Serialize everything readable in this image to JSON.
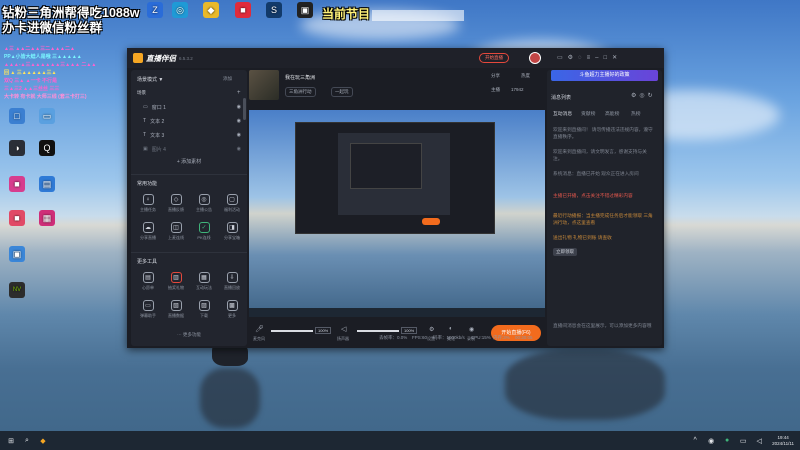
{
  "overlay": {
    "line1": "钻粉三角洲帮得吃1088w",
    "line2": "办卡进微信粉丝群",
    "program_label": "当前节目",
    "small_lines": [
      "▲三 ▲▲二▲▲三二▲▲▲二▲",
      "PP▲小皆大蛙人是哦 三▲▲▲▲▲",
      "▲▲▲-▲三▲▲▲▲▲▲三▲▲▲  二▲▲",
      "回 ▲ 三▲▲▲▲▲三▲",
      "双Q   三▲ ▲一卡 不行是",
      "三▲三2 ▲▲三丝丝 三三",
      "大卡转 有卡就  大师三线 (套三卡打三)"
    ]
  },
  "desktop_icons": [
    {
      "label": "",
      "glyph": "Z"
    },
    {
      "label": "",
      "glyph": "◎"
    },
    {
      "label": "",
      "glyph": "◆"
    },
    {
      "label": "",
      "glyph": "■"
    },
    {
      "label": "",
      "glyph": "S"
    },
    {
      "label": "",
      "glyph": "▣"
    },
    {
      "label": "",
      "glyph": "□"
    },
    {
      "label": "",
      "glyph": "▭"
    },
    {
      "label": "",
      "glyph": "◑"
    },
    {
      "label": "",
      "glyph": "Q"
    },
    {
      "label": "",
      "glyph": "■"
    },
    {
      "label": "",
      "glyph": "▤"
    },
    {
      "label": "",
      "glyph": "■"
    },
    {
      "label": "",
      "glyph": "▦"
    },
    {
      "label": "",
      "glyph": "▣"
    },
    {
      "label": "",
      "glyph": "NV"
    }
  ],
  "app": {
    "title": "直播伴侣",
    "version": "6.5.3.2",
    "live_label": "开始直播",
    "scene_label": "场景模式 ▼",
    "scene_add": "添加",
    "sources_tab": "场景",
    "sources": [
      "窗口 1",
      "文本 2",
      "文本 3",
      "图片 4"
    ],
    "add_source": "+ 添加素材",
    "tools_header": "常用功能",
    "tools_row1": [
      "主播任务",
      "直播反馈",
      "主播公告",
      "福利活动"
    ],
    "tools_row2": [
      "分享直播",
      "上麦连线",
      "PK连线",
      "分享宝箱"
    ],
    "more_tools_header": "更多工具",
    "tools_row3": [
      "心愿单",
      "抽奖礼物",
      "互动玩法",
      "直播回放"
    ],
    "tools_row4": [
      "弹幕助手",
      "直播数据",
      "下载",
      "更多"
    ],
    "more_link": "··· 更多功能",
    "stream_title": "我在玩三角洲",
    "stream_tags": [
      "三角洲行动",
      "一起玩"
    ],
    "top_actions": [
      "分享",
      "热度",
      "主播",
      "17942"
    ],
    "mic_label": "麦克风",
    "mic_pct": "100%",
    "speaker_label": "扬声器",
    "speaker_pct": "100%",
    "bottom_icons": [
      "设置",
      "美化",
      "录制"
    ],
    "start_btn": "开始直播(F6)",
    "stats": [
      "丢帧率：0.0%",
      "FPS:60",
      "码率：1000kb/s",
      "CPU:15%",
      "内存:3%",
      "00:30:05"
    ]
  },
  "chat": {
    "banner": "斗鱼超力主播好的政策",
    "tabs": [
      "互动消息",
      "贡献榜",
      "高能榜",
      "热榜"
    ],
    "header": "消息列表",
    "messages": [
      "欢迎来到直播间！ 请勿传播违法违规内容，遵守直播秩序。",
      "欢迎来到直播间，请文明发言，感谢支持与关注。",
      "系统消息：直播已开始 观众正在进入房间",
      "主播已开播，点击关注不错过精彩内容",
      "最近行动播报：当主播完成任务后才能领取 三角洲行动，点这里查看",
      "送出礼物 礼物已到账 请查收",
      "立即领取"
    ],
    "footer": "直播间消息会在这里展示，可以添加更多内容哦"
  },
  "taskbar": {
    "time": "19:44",
    "date": "2024/11/11"
  }
}
